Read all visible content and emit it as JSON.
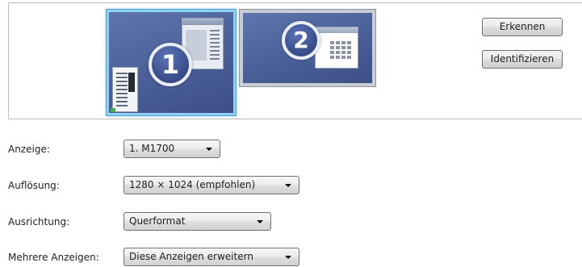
{
  "preview": {
    "monitors": [
      {
        "number": "1",
        "selected": true
      },
      {
        "number": "2",
        "selected": false
      }
    ]
  },
  "buttons": {
    "detect": "Erkennen",
    "identify": "Identifizieren"
  },
  "settings": {
    "display": {
      "label": "Anzeige:",
      "value": "1. M1700"
    },
    "resolution": {
      "label": "Auflösung:",
      "value": "1280 × 1024 (empfohlen)"
    },
    "orientation": {
      "label": "Ausrichtung:",
      "value": "Querformat"
    },
    "multiple": {
      "label": "Mehrere Anzeigen:",
      "value": "Diese Anzeigen erweitern"
    }
  },
  "colors": {
    "selection_border": "#8fd1f3",
    "monitor_fill": "#4a5f98"
  }
}
